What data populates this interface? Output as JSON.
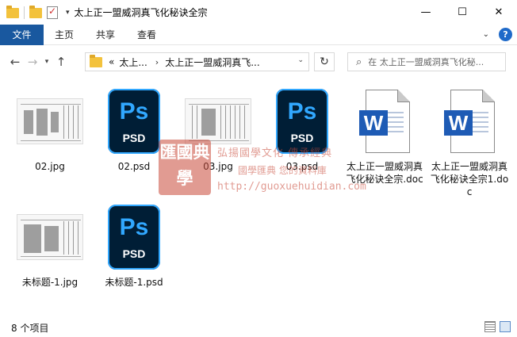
{
  "window": {
    "title": "太上正一盟威洞真飞化秘诀全宗",
    "controls": {
      "minimize": "—",
      "maximize": "☐",
      "close": "✕"
    }
  },
  "ribbon": {
    "file_tab": "文件",
    "tabs": [
      "主页",
      "共享",
      "查看"
    ],
    "help": "?"
  },
  "address": {
    "overflow": "«",
    "crumbs": [
      "太上...",
      "太上正一盟威洞真飞..."
    ],
    "search_placeholder": "在 太上正一盟威洞真飞化秘..."
  },
  "files": [
    {
      "name": "02.jpg",
      "type": "jpg"
    },
    {
      "name": "02.psd",
      "type": "psd"
    },
    {
      "name": "03.jpg",
      "type": "jpg"
    },
    {
      "name": "03.psd",
      "type": "psd"
    },
    {
      "name": "太上正一盟威洞真飞化秘诀全宗.doc",
      "type": "doc"
    },
    {
      "name": "太上正一盟威洞真飞化秘诀全宗1.doc",
      "type": "doc"
    },
    {
      "name": "未标题-1.jpg",
      "type": "jpg"
    },
    {
      "name": "未标题-1.psd",
      "type": "psd"
    }
  ],
  "icons": {
    "ps_text": "Ps",
    "psd_text": "PSD",
    "word_letter": "W"
  },
  "watermark": {
    "seal": "匯國典學",
    "line1": "弘揚國學文化 傳承經典",
    "line2": "國學匯典 您的資料庫",
    "url": "http://guoxuehuidian.com"
  },
  "status": {
    "item_count": "8 个项目"
  },
  "colors": {
    "file_tab": "#19589f",
    "ps_bg": "#001e36",
    "ps_accent": "#31a8ff",
    "word_blue": "#1e5bb5"
  }
}
